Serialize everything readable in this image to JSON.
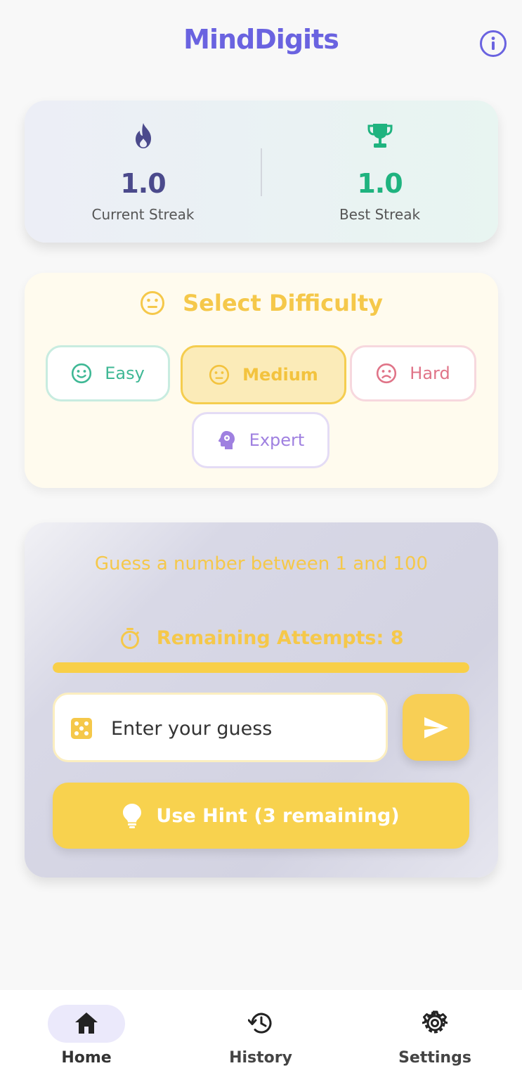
{
  "app": {
    "title": "MindDigits"
  },
  "streaks": {
    "current": {
      "value": "1.0",
      "label": "Current Streak",
      "color": "#4b4a8c"
    },
    "best": {
      "value": "1.0",
      "label": "Best Streak",
      "color": "#1fb37f"
    }
  },
  "difficulty": {
    "title": "Select Difficulty",
    "options": [
      {
        "label": "Easy",
        "selected": false
      },
      {
        "label": "Medium",
        "selected": true
      },
      {
        "label": "Hard",
        "selected": false
      },
      {
        "label": "Expert",
        "selected": false
      }
    ]
  },
  "game": {
    "prompt": "Guess a number between 1 and 100",
    "attempts_label": "Remaining Attempts: 8",
    "attempts_progress": 1.0,
    "input_placeholder": "Enter your guess",
    "hint_label": "Use Hint (3 remaining)"
  },
  "nav": {
    "items": [
      {
        "label": "Home",
        "icon": "home-icon",
        "active": true
      },
      {
        "label": "History",
        "icon": "history-icon",
        "active": false
      },
      {
        "label": "Settings",
        "icon": "gear-icon",
        "active": false
      }
    ]
  },
  "colors": {
    "brand": "#6a63e0",
    "accent_yellow": "#f8cf48",
    "easy": "#3fb895",
    "hard": "#e07488",
    "expert": "#9f80e0"
  }
}
